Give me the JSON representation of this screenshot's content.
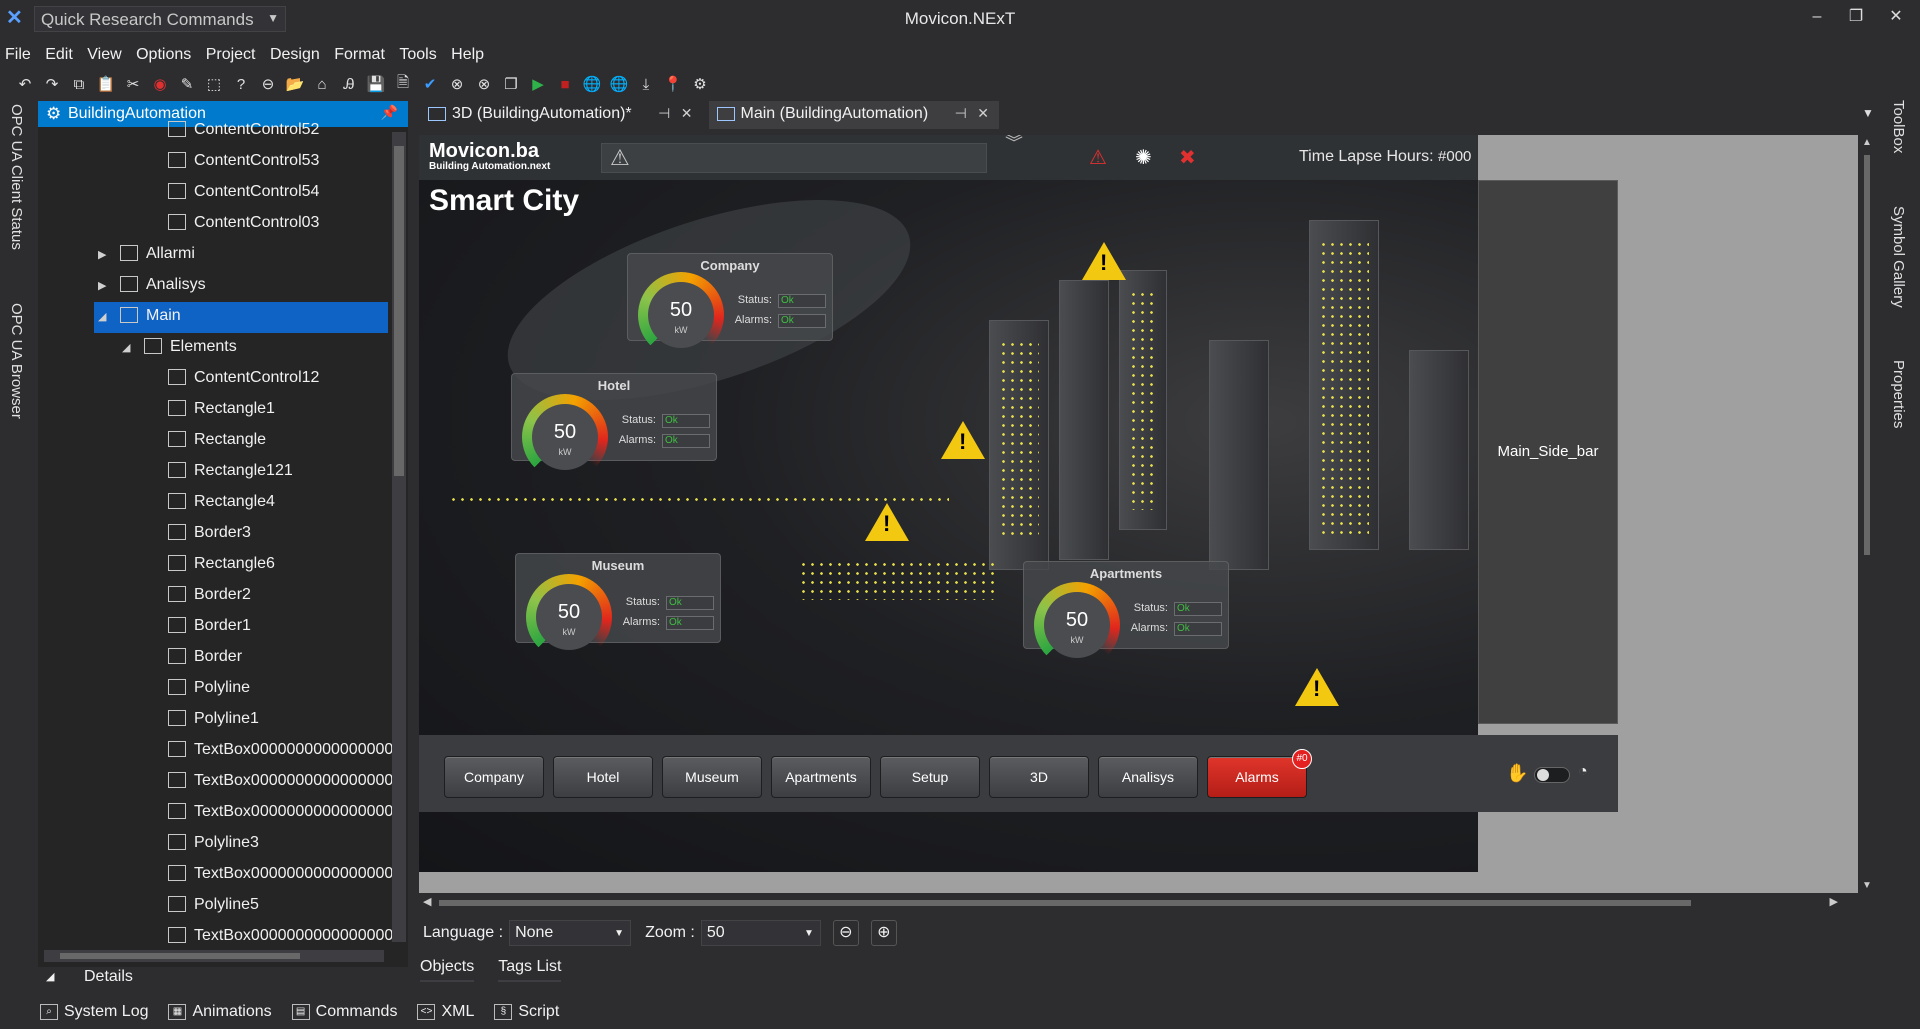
{
  "app": {
    "title": "Movicon.NExT",
    "quick_commands": "Quick Research Commands"
  },
  "window_controls": {
    "minimize": "–",
    "restore": "❐",
    "close": "✕"
  },
  "menu": [
    "File",
    "Edit",
    "View",
    "Options",
    "Project",
    "Design",
    "Format",
    "Tools",
    "Help"
  ],
  "left_panels": [
    "OPC UA Client Status",
    "OPC UA Browser"
  ],
  "right_panels": [
    "ToolBox",
    "Symbol Gallery",
    "Properties"
  ],
  "explorer": {
    "title": "BuildingAutomation",
    "items": [
      {
        "label": "ContentControl52",
        "indent": 3
      },
      {
        "label": "ContentControl53",
        "indent": 3
      },
      {
        "label": "ContentControl54",
        "indent": 3
      },
      {
        "label": "ContentControl03",
        "indent": 3
      },
      {
        "label": "Allarmi",
        "indent": 1,
        "expander": "▶"
      },
      {
        "label": "Analisys",
        "indent": 1,
        "expander": "▶"
      },
      {
        "label": "Main",
        "indent": 1,
        "expander": "◢",
        "selected": true
      },
      {
        "label": "Elements",
        "indent": 2,
        "expander": "◢"
      },
      {
        "label": "ContentControl12",
        "indent": 3
      },
      {
        "label": "Rectangle1",
        "indent": 3
      },
      {
        "label": "Rectangle",
        "indent": 3
      },
      {
        "label": "Rectangle121",
        "indent": 3
      },
      {
        "label": "Rectangle4",
        "indent": 3
      },
      {
        "label": "Border3",
        "indent": 3
      },
      {
        "label": "Rectangle6",
        "indent": 3
      },
      {
        "label": "Border2",
        "indent": 3
      },
      {
        "label": "Border1",
        "indent": 3
      },
      {
        "label": "Border",
        "indent": 3
      },
      {
        "label": "Polyline",
        "indent": 3
      },
      {
        "label": "Polyline1",
        "indent": 3
      },
      {
        "label": "TextBox000000000000000000",
        "indent": 3
      },
      {
        "label": "TextBox000000000000000000",
        "indent": 3
      },
      {
        "label": "TextBox000000000000000000",
        "indent": 3
      },
      {
        "label": "Polyline3",
        "indent": 3
      },
      {
        "label": "TextBox000000000000000000",
        "indent": 3
      },
      {
        "label": "Polyline5",
        "indent": 3
      },
      {
        "label": "TextBox000000000000000000",
        "indent": 3
      }
    ],
    "details_label": "Details"
  },
  "bottom_tabs": [
    "System Log",
    "Animations",
    "Commands",
    "XML",
    "Script"
  ],
  "doc_tabs": [
    {
      "label": "3D (BuildingAutomation)*",
      "active": false
    },
    {
      "label": "Main (BuildingAutomation)",
      "active": true
    }
  ],
  "hmi": {
    "logo_main": "Movicon.ba",
    "logo_sub": "Building Automation.next",
    "title": "Smart City",
    "time_lapse_label": "Time Lapse Hours:",
    "time_lapse_value": "#000",
    "clock_value": "#0",
    "side_bar_label": "Main_Side_bar",
    "panels": [
      {
        "title": "Company",
        "value": "50",
        "unit": "kW",
        "status_label": "Status:",
        "alarms_label": "Alarms:",
        "status": "Ok",
        "alarms": "Ok"
      },
      {
        "title": "Hotel",
        "value": "50",
        "unit": "kW",
        "status_label": "Status:",
        "alarms_label": "Alarms:",
        "status": "Ok",
        "alarms": "Ok"
      },
      {
        "title": "Museum",
        "value": "50",
        "unit": "kW",
        "status_label": "Status:",
        "alarms_label": "Alarms:",
        "status": "Ok",
        "alarms": "Ok"
      },
      {
        "title": "Apartments",
        "value": "50",
        "unit": "kW",
        "status_label": "Status:",
        "alarms_label": "Alarms:",
        "status": "Ok",
        "alarms": "Ok"
      }
    ],
    "nav_buttons": [
      "Company",
      "Hotel",
      "Museum",
      "Apartments",
      "Setup",
      "3D",
      "Analisys",
      "Alarms"
    ],
    "alarm_badge": "#0"
  },
  "status_bar": {
    "language_label": "Language :",
    "language_value": "None",
    "zoom_label": "Zoom :",
    "zoom_value": "50"
  },
  "object_tabs": [
    "Objects",
    "Tags List"
  ],
  "colors": {
    "accent": "#007acc",
    "selection": "#0e63c4",
    "warning": "#f2c811",
    "alarm_button": "#c8231b"
  }
}
